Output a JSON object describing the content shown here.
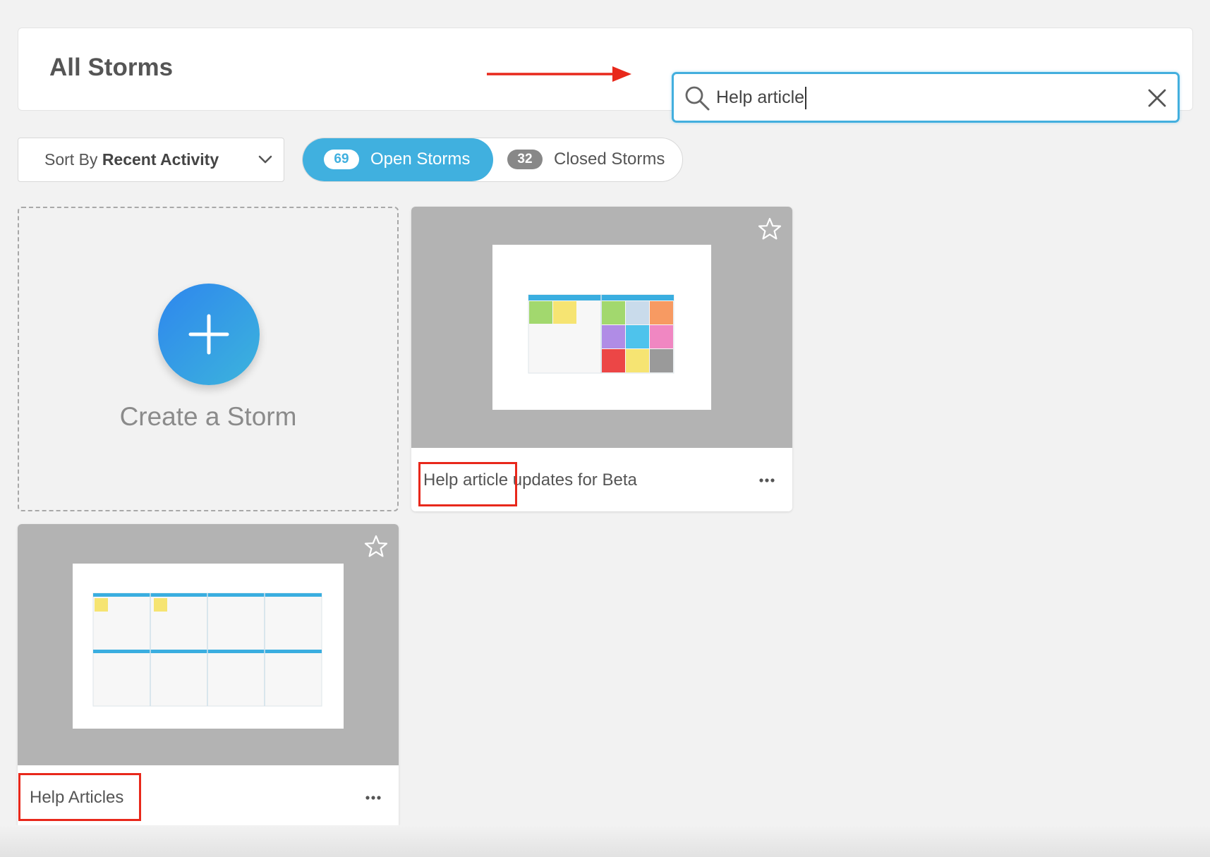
{
  "header": {
    "title": "All Storms",
    "search": {
      "value": "Help article",
      "placeholder": "Search"
    }
  },
  "controls": {
    "sort_prefix": "Sort By",
    "sort_value": "Recent Activity",
    "tabs": [
      {
        "count": "69",
        "label": "Open Storms",
        "active": true
      },
      {
        "count": "32",
        "label": "Closed Storms",
        "active": false
      }
    ]
  },
  "create_card": {
    "label": "Create a Storm"
  },
  "storms": [
    {
      "title_prefix": "Help article",
      "title_rest": " updates for Beta"
    },
    {
      "title_prefix": "Help Articles",
      "title_rest": ""
    }
  ],
  "colors": {
    "accent": "#40b0df",
    "annotation": "#e8281b",
    "thumbnail_bg": "#b3b3b3"
  }
}
